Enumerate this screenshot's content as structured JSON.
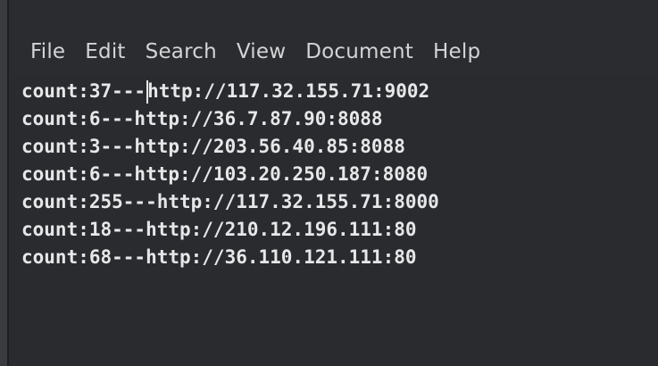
{
  "menu": {
    "items": [
      "File",
      "Edit",
      "Search",
      "View",
      "Document",
      "Help"
    ]
  },
  "editor": {
    "lines": [
      "count:37---http://117.32.155.71:9002",
      "count:6---http://36.7.87.90:8088",
      "count:3---http://203.56.40.85:8088",
      "count:6---http://103.20.250.187:8080",
      "count:255---http://117.32.155.71:8000",
      "count:18---http://210.12.196.111:80",
      "count:68---http://36.110.121.111:80"
    ]
  }
}
